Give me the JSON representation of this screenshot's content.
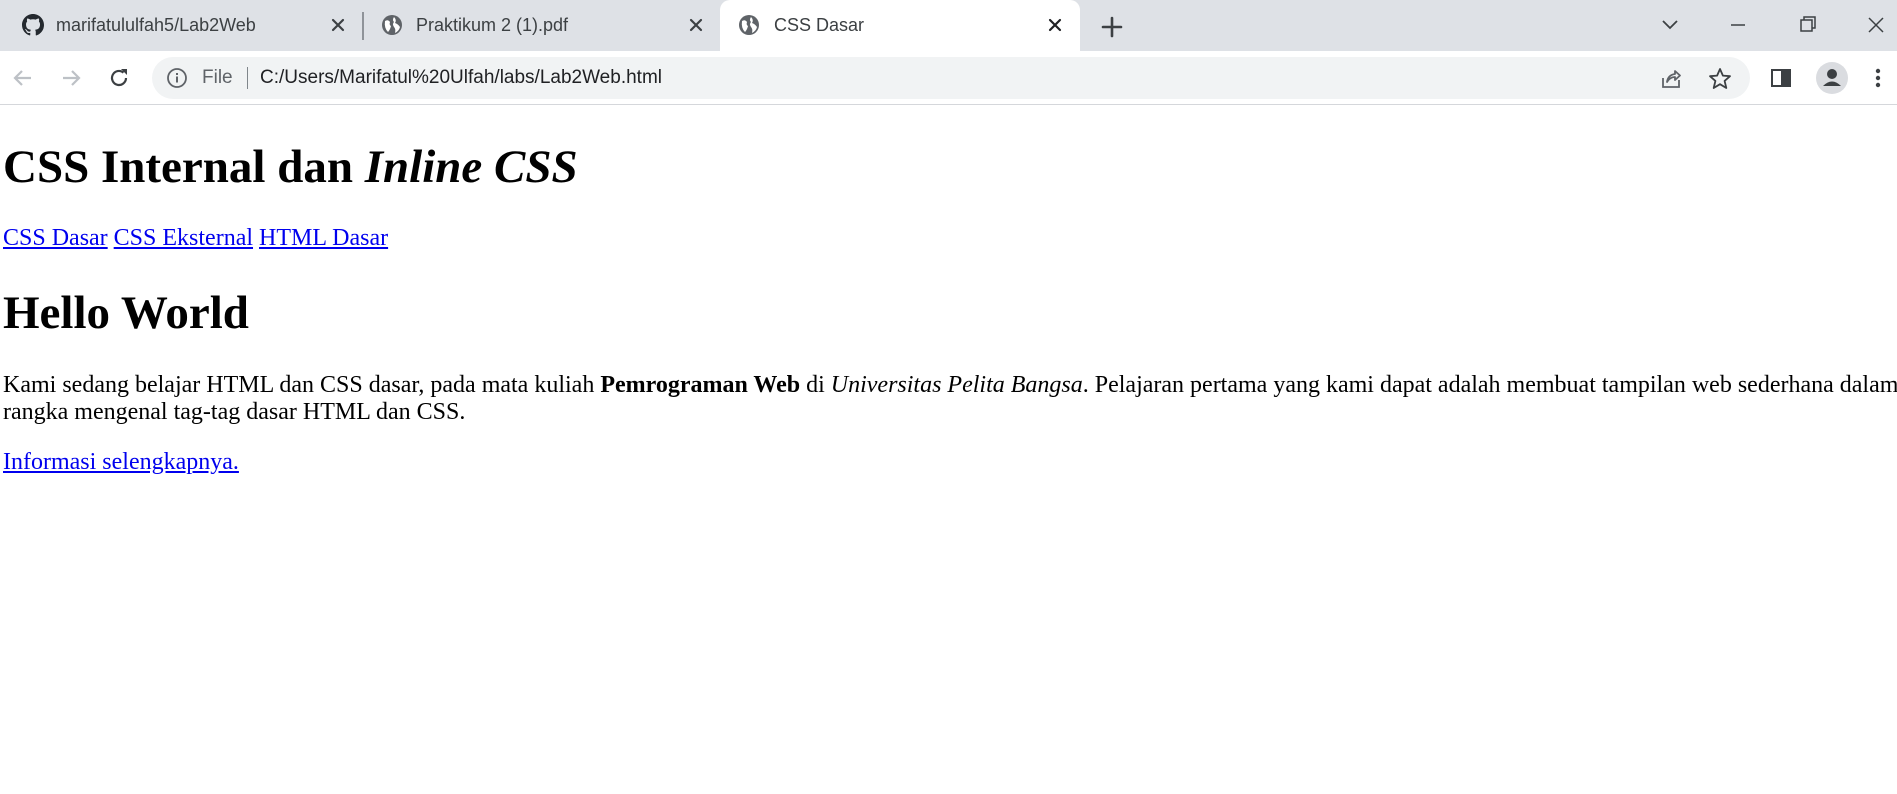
{
  "browser": {
    "tabs": [
      {
        "title": "marifatululfah5/Lab2Web",
        "icon": "github-icon",
        "active": false
      },
      {
        "title": "Praktikum 2 (1).pdf",
        "icon": "globe-icon",
        "active": false
      },
      {
        "title": "CSS Dasar",
        "icon": "globe-icon",
        "active": true
      }
    ],
    "address": {
      "scheme_label": "File",
      "url": "C:/Users/Marifatul%20Ulfah/labs/Lab2Web.html"
    }
  },
  "page": {
    "heading1": {
      "plain": "CSS Internal dan ",
      "italic": "Inline CSS"
    },
    "nav_links": [
      "CSS Dasar",
      "CSS Eksternal",
      "HTML Dasar"
    ],
    "heading2": "Hello World",
    "paragraph": {
      "part1": "Kami sedang belajar HTML dan CSS dasar, pada mata kuliah ",
      "bold": "Pemrograman Web",
      "part2": " di ",
      "italic": "Universitas Pelita Bangsa",
      "part3": ". Pelajaran pertama yang kami dapat adalah membuat tampilan web sederhana dalam rangka mengenal tag-tag dasar HTML dan CSS."
    },
    "more_link": "Informasi selengkapnya."
  },
  "colors": {
    "tabstrip_bg": "#dee1e6",
    "omnibox_bg": "#f1f3f4",
    "link": "#0000ee"
  }
}
